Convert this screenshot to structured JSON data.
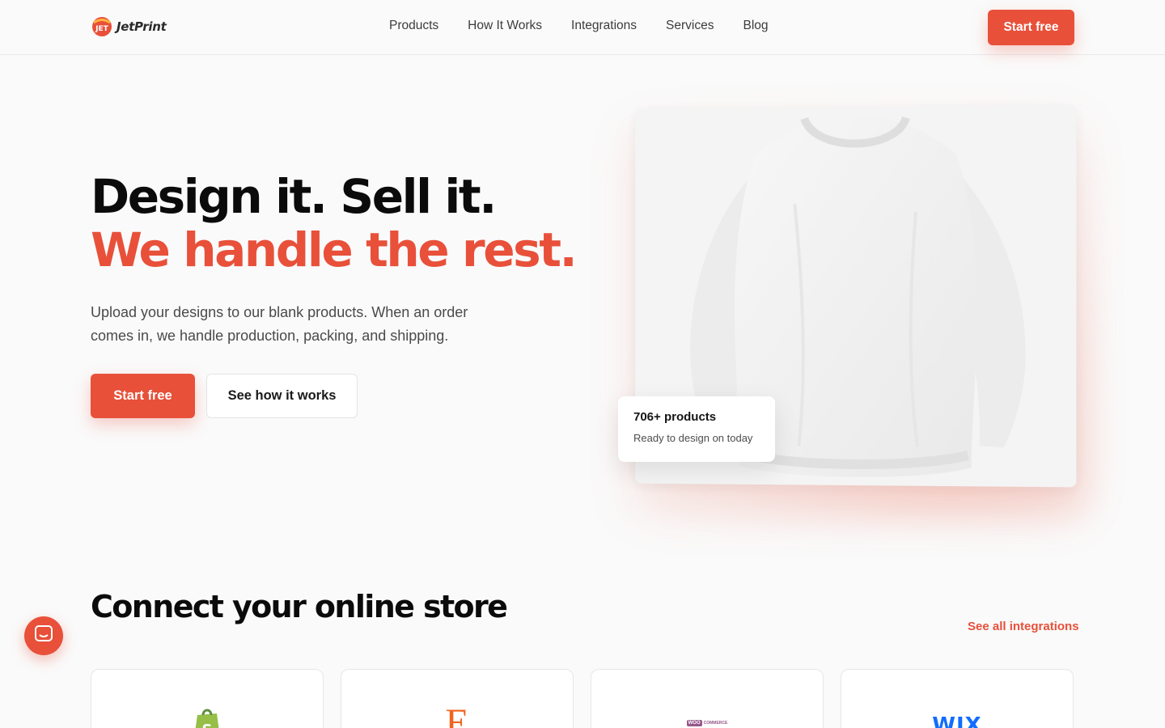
{
  "brand": {
    "logo_mark_text": "JET",
    "name": "JetPrint",
    "accent_color": "#e8503a"
  },
  "nav": {
    "items": [
      {
        "label": "Products"
      },
      {
        "label": "How It Works"
      },
      {
        "label": "Integrations"
      },
      {
        "label": "Services"
      },
      {
        "label": "Blog"
      }
    ],
    "cta_label": "Start free"
  },
  "hero": {
    "title_dark": "Design it. Sell it. ",
    "title_accent": "We handle the rest.",
    "subtitle": "Upload your designs to our blank products. When an order comes in, we handle production, packing, and shipping.",
    "primary_cta": "Start free",
    "secondary_cta": "See how it works",
    "product_image": "white-sweatshirt",
    "stat": {
      "value": "706+ products",
      "label": "Ready to design on today"
    }
  },
  "integrations": {
    "title": "Connect your online store",
    "see_all_label": "See all integrations",
    "cards": [
      {
        "name": "shopify",
        "icon": "shopify-icon"
      },
      {
        "name": "etsy",
        "icon": "etsy-icon",
        "glyph": "E"
      },
      {
        "name": "woocommerce",
        "icon": "woocommerce-icon",
        "badge": "WOO",
        "text": "COMMERCE"
      },
      {
        "name": "wix",
        "icon": "wix-icon",
        "text": "WIX"
      }
    ]
  },
  "chat": {
    "icon": "chat-icon"
  }
}
